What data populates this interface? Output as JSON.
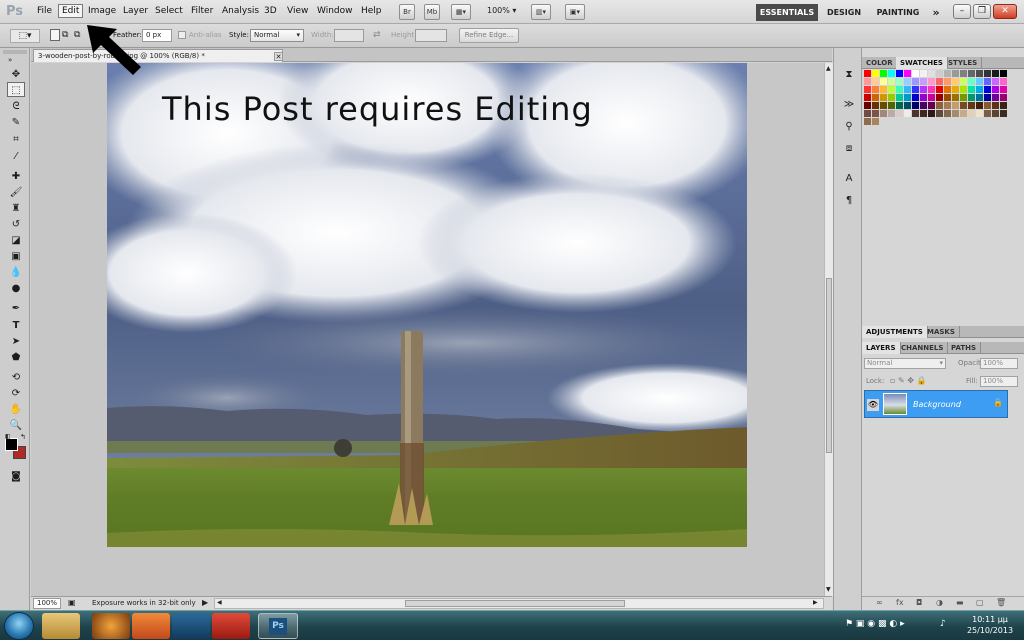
{
  "app": {
    "logo": "Ps"
  },
  "menu": [
    "File",
    "Edit",
    "Image",
    "Layer",
    "Select",
    "Filter",
    "Analysis",
    "3D",
    "View",
    "Window",
    "Help"
  ],
  "appbar": {
    "zoom": "100%",
    "mode_br": "Br",
    "mode_mb": "Mb"
  },
  "workspaces": {
    "active": "ESSENTIALS",
    "design": "DESIGN",
    "painting": "PAINTING",
    "more": "»"
  },
  "window_controls": {
    "minimize": "–",
    "restore": "❐",
    "close": "✕"
  },
  "options": {
    "feather_label": "Feather:",
    "feather_value": "0 px",
    "antialias_label": "Anti-alias",
    "style_label": "Style:",
    "style_value": "Normal",
    "width_label": "Width:",
    "height_label": "Height:",
    "refine_edge": "Refine Edge..."
  },
  "document": {
    "tab_title": "3-wooden-post-by-robert.jpg @ 100% (RGB/8) *",
    "tab_close": "✕",
    "overlay_text": "This Post requires Editing",
    "status_zoom": "100%",
    "status_info": "Exposure works in 32-bit only"
  },
  "swatches_panel": {
    "tabs": [
      "COLOR",
      "SWATCHES",
      "STYLES"
    ],
    "active_tab": "SWATCHES",
    "colors": [
      "#ff0000",
      "#ffff00",
      "#00ff00",
      "#00ffff",
      "#0000ff",
      "#ff00ff",
      "#ffffff",
      "#f2f2f2",
      "#e0e0e0",
      "#cccccc",
      "#b3b3b3",
      "#999999",
      "#808080",
      "#666666",
      "#4d4d4d",
      "#333333",
      "#1a1a1a",
      "#000000",
      "#ff9999",
      "#ffcc99",
      "#ffff99",
      "#ccff99",
      "#99ffcc",
      "#99ccff",
      "#9999ff",
      "#cc99ff",
      "#ff99cc",
      "#ff6666",
      "#ff9966",
      "#ffcc66",
      "#ccff66",
      "#66ffcc",
      "#66ccff",
      "#6666ff",
      "#cc66ff",
      "#ff66cc",
      "#ff3333",
      "#ff8033",
      "#ffb833",
      "#b8ff33",
      "#33ffb8",
      "#33b8ff",
      "#3333ff",
      "#b833ff",
      "#ff33b8",
      "#e60000",
      "#e67300",
      "#e6ac00",
      "#ace600",
      "#00e6ac",
      "#00ace6",
      "#0000e6",
      "#ac00e6",
      "#e600ac",
      "#cc0000",
      "#cc6600",
      "#cc9900",
      "#99cc00",
      "#00cc99",
      "#0099cc",
      "#0000cc",
      "#9900cc",
      "#cc0099",
      "#990000",
      "#994c00",
      "#997300",
      "#739900",
      "#009973",
      "#007399",
      "#000099",
      "#730099",
      "#990073",
      "#660000",
      "#663300",
      "#664d00",
      "#4d6600",
      "#00664d",
      "#004d66",
      "#000066",
      "#4d0066",
      "#66004d",
      "#8c6239",
      "#a67c52",
      "#c69c6d",
      "#754c24",
      "#603913",
      "#42210b",
      "#8b5a2b",
      "#5c3317",
      "#3b2314",
      "#6d4c41",
      "#795548",
      "#a1887f",
      "#bcaaa4",
      "#d7ccc8",
      "#efebe9",
      "#4e342e",
      "#3e2723",
      "#2b1b17",
      "#604a3a",
      "#826850",
      "#a58a6e",
      "#c4ab8c",
      "#e2d1b8",
      "#efe3d0",
      "#7b5e45",
      "#5a4532",
      "#3a2c20",
      "#8e6b4c",
      "#a8855f"
    ]
  },
  "adjustments_panel": {
    "tabs": [
      "ADJUSTMENTS",
      "MASKS"
    ],
    "active_tab": "ADJUSTMENTS"
  },
  "layers_panel": {
    "tabs": [
      "LAYERS",
      "CHANNELS",
      "PATHS"
    ],
    "active_tab": "LAYERS",
    "blend_mode": "Normal",
    "opacity_label": "Opacity:",
    "opacity_value": "100%",
    "lock_label": "Lock:",
    "fill_label": "Fill:",
    "fill_value": "100%",
    "layers": [
      {
        "name": "Background",
        "visible": true,
        "locked": true,
        "selected": true
      }
    ]
  },
  "taskbar": {
    "time": "10:11 μμ",
    "date": "25/10/2013"
  },
  "colors": {
    "selection_blue": "#3d9df3",
    "foreground": "#000000",
    "background": "#b02a2a"
  }
}
